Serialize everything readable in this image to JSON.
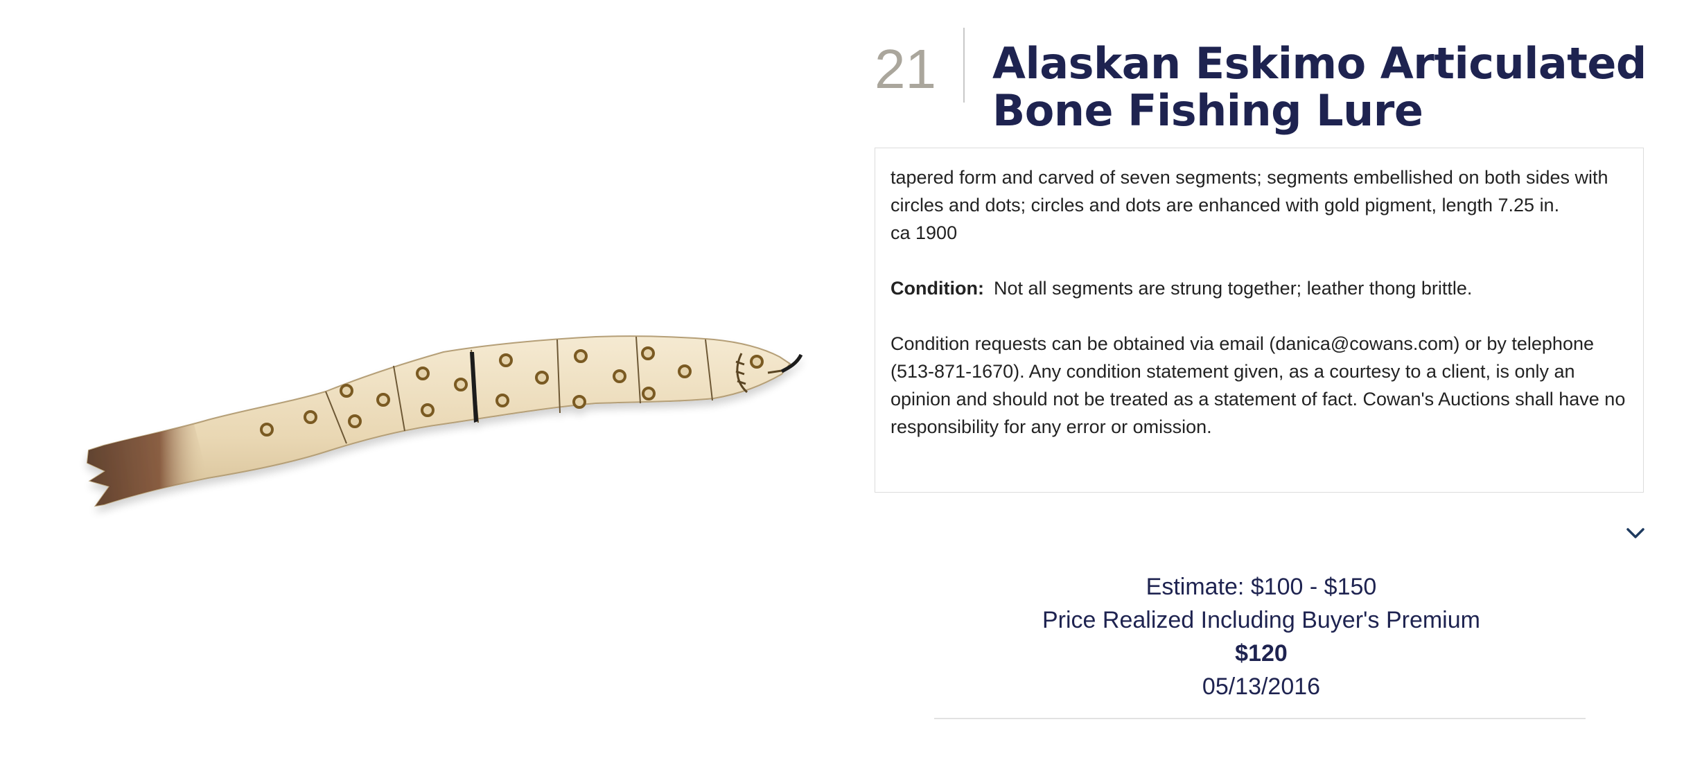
{
  "lot": {
    "number": "21",
    "title": "Alaskan Eskimo Articulated Bone Fishing Lure"
  },
  "image": {
    "subject": "lure-photo"
  },
  "description": {
    "text": "tapered form and carved of seven segments; segments embellished on both sides with circles and dots; circles and dots are enhanced with gold pigment, length 7.25 in.",
    "date": "ca 1900",
    "condition_label": "Condition:",
    "condition_text": "Not all segments are strung together; leather thong brittle.",
    "notice": "Condition requests can be obtained via email (danica@cowans.com) or by telephone (513-871-1670). Any condition statement given, as a courtesy to a client, is only an opinion and should not be treated as a statement of fact. Cowan's Auctions shall have no responsibility for any error or omission."
  },
  "expand": {
    "icon": "chevron-down-icon"
  },
  "pricing": {
    "estimate": "Estimate: $100 - $150",
    "realized_label": "Price Realized Including Buyer's Premium",
    "realized_value": "$120",
    "sale_date": "05/13/2016"
  },
  "colors": {
    "title": "#1e2350",
    "lot_number": "#aaa69c",
    "bone": "#ecdcbc",
    "pigment": "#8a6a2e"
  }
}
